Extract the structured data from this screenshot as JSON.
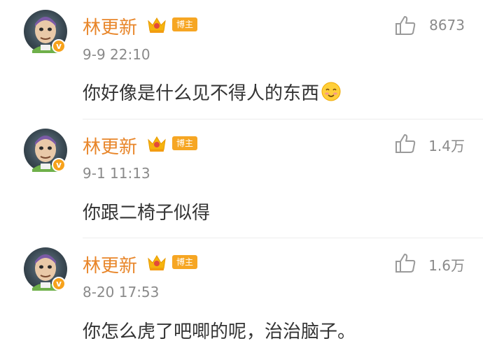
{
  "comments": [
    {
      "username": "林更新",
      "badge": "博主",
      "verified_badge": "v",
      "timestamp": "9-9 22:10",
      "text": "你好像是什么见不得人的东西",
      "emoji": "blush-emoji",
      "likes": "8673"
    },
    {
      "username": "林更新",
      "badge": "博主",
      "verified_badge": "v",
      "timestamp": "9-1 11:13",
      "text": "你跟二椅子似得",
      "likes": "1.4万"
    },
    {
      "username": "林更新",
      "badge": "博主",
      "verified_badge": "v",
      "timestamp": "8-20 17:53",
      "text": "你怎么虎了吧唧的呢，治治脑子。",
      "likes": "1.6万"
    }
  ],
  "colors": {
    "username": "#e8862a",
    "badge": "#f6a623",
    "verified": "#f7a21b",
    "meta": "#8a8a8a",
    "text": "#333333"
  }
}
